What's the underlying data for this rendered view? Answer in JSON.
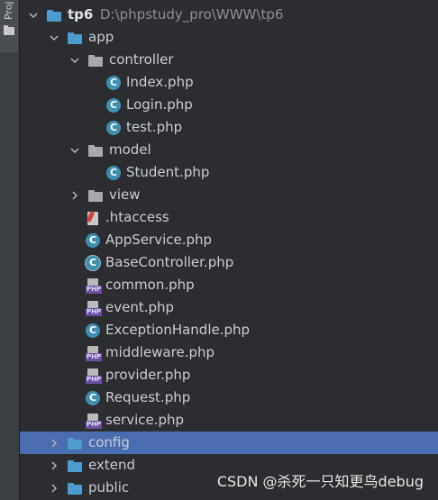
{
  "sidebar_tab": {
    "label": "Proj"
  },
  "tree": [
    {
      "name": "tp6",
      "path": "D:\\phpstudy_pro\\WWW\\tp6",
      "type": "folder",
      "color": "blue",
      "depth": 0,
      "expanded": true,
      "bold": true
    },
    {
      "name": "app",
      "type": "folder",
      "color": "blue",
      "depth": 1,
      "expanded": true
    },
    {
      "name": "controller",
      "type": "folder",
      "color": "grey",
      "depth": 2,
      "expanded": true
    },
    {
      "name": "Index.php",
      "type": "class",
      "depth": 3
    },
    {
      "name": "Login.php",
      "type": "class",
      "depth": 3
    },
    {
      "name": "test.php",
      "type": "class",
      "depth": 3
    },
    {
      "name": "model",
      "type": "folder",
      "color": "grey",
      "depth": 2,
      "expanded": true
    },
    {
      "name": "Student.php",
      "type": "class",
      "depth": 3
    },
    {
      "name": "view",
      "type": "folder",
      "color": "grey",
      "depth": 2,
      "expanded": false
    },
    {
      "name": ".htaccess",
      "type": "htaccess",
      "depth": 2
    },
    {
      "name": "AppService.php",
      "type": "class",
      "depth": 2
    },
    {
      "name": "BaseController.php",
      "type": "class-abstract",
      "depth": 2
    },
    {
      "name": "common.php",
      "type": "php",
      "depth": 2
    },
    {
      "name": "event.php",
      "type": "php",
      "depth": 2
    },
    {
      "name": "ExceptionHandle.php",
      "type": "class",
      "depth": 2
    },
    {
      "name": "middleware.php",
      "type": "php",
      "depth": 2
    },
    {
      "name": "provider.php",
      "type": "php",
      "depth": 2
    },
    {
      "name": "Request.php",
      "type": "class",
      "depth": 2
    },
    {
      "name": "service.php",
      "type": "php",
      "depth": 2
    },
    {
      "name": "config",
      "type": "folder",
      "color": "blue",
      "depth": 1,
      "expanded": false,
      "selected": true
    },
    {
      "name": "extend",
      "type": "folder",
      "color": "blue",
      "depth": 1,
      "expanded": false
    },
    {
      "name": "public",
      "type": "folder",
      "color": "blue",
      "depth": 1,
      "expanded": false
    }
  ],
  "icons": {
    "class": "class-c-icon",
    "php": "php-file-icon",
    "htaccess": "htaccess-icon",
    "folder": "folder-icon"
  },
  "colors": {
    "selection": "#4a6cb0",
    "folder_blue": "#4e9bcf",
    "folder_grey": "#a7a9ad",
    "class_icon": "#3e8fb0",
    "php_badge": "#6b4fa3"
  },
  "watermark": "CSDN @杀死一只知更鸟debug"
}
